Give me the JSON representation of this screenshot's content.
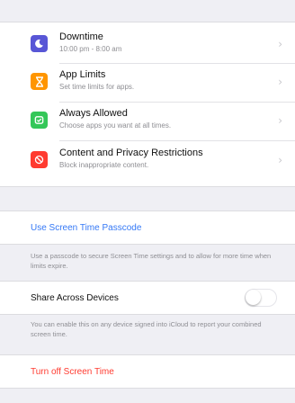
{
  "colors": {
    "background": "#efeff4",
    "accent_blue": "#3478f6",
    "destructive_red": "#ff3b30",
    "downtime_icon": "#5856d6",
    "app_limits_icon": "#ff9500",
    "always_allowed_icon": "#34c759",
    "restrictions_icon": "#ff3b30"
  },
  "settings": {
    "items": [
      {
        "title": "Downtime",
        "subtitle": "10:00 pm - 8:00 am",
        "icon": "moon-icon"
      },
      {
        "title": "App Limits",
        "subtitle": "Set time limits for apps.",
        "icon": "hourglass-icon"
      },
      {
        "title": "Always Allowed",
        "subtitle": "Choose apps you want at all times.",
        "icon": "checkmark-bubble-icon"
      },
      {
        "title": "Content and Privacy Restrictions",
        "subtitle": "Block inappropriate content.",
        "icon": "no-entry-icon"
      }
    ]
  },
  "passcode": {
    "link_label": "Use Screen Time Passcode",
    "note": "Use a passcode to secure Screen Time settings and to allow for more time when limits expire."
  },
  "share": {
    "label": "Share Across Devices",
    "enabled": false,
    "note": "You can enable this on any device signed into iCloud to report your combined screen time."
  },
  "turn_off": {
    "label": "Turn off Screen Time"
  }
}
